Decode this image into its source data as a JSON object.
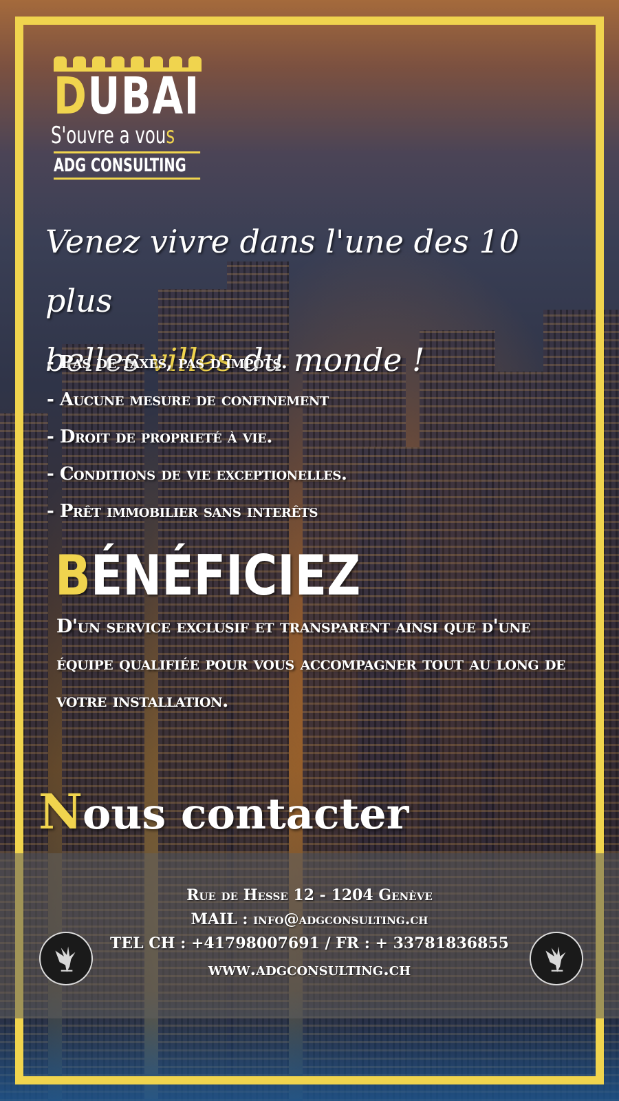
{
  "colors": {
    "accent": "#f0d44e",
    "text": "#ffffff"
  },
  "logo": {
    "brand_first": "D",
    "brand_rest": "UBAI",
    "tagline_main": "S'ouvre a vou",
    "tagline_end": "s",
    "company": "ADG CONSULTING"
  },
  "headline": {
    "line1": "Venez vivre dans l'une des 10 plus",
    "line2_start": "belles ",
    "line2_highlight": "villes",
    "line2_end": " du monde !"
  },
  "bullets": [
    "- Pas de taxes, pas d'impôts.",
    "- Aucune mesure de confinement",
    "- Droit de proprieté à vie.",
    "- Conditions de vie exceptionelles.",
    "- Prêt immobilier sans interêts"
  ],
  "benefits": {
    "title_first": "B",
    "title_rest": "ÉNÉFICIEZ",
    "text": "D'un service exclusif et transparent ainsi que d'une équipe qualifiée pour vous accompagner tout au long de votre installation."
  },
  "contact": {
    "title_first": "N",
    "title_rest": "ous contacter",
    "address": "Rue de Hesse 12 - 1204 Genève",
    "mail": "MAIL : info@adgconsulting.ch",
    "tel": "TEL CH : +41798007691 / FR : + 33781836855",
    "website": "www.adgconsulting.ch",
    "emblem_icon": "eagle-icon"
  }
}
